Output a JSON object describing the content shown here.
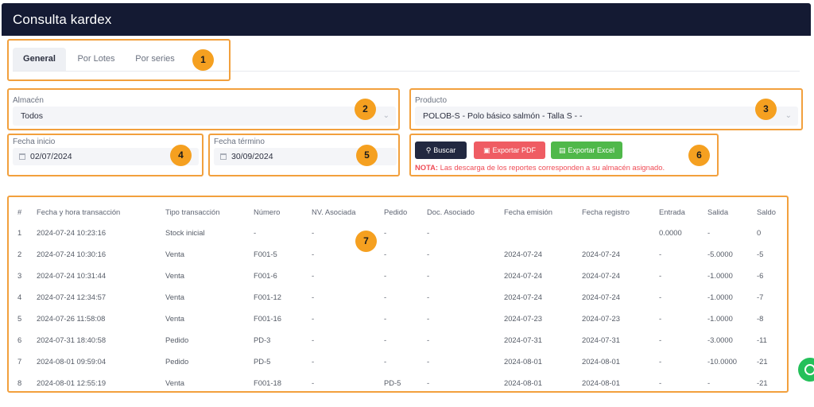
{
  "header": {
    "title": "Consulta kardex"
  },
  "tabs": [
    {
      "label": "General",
      "active": true
    },
    {
      "label": "Por Lotes",
      "active": false
    },
    {
      "label": "Por series",
      "active": false
    }
  ],
  "filters": {
    "almacen": {
      "label": "Almacén",
      "value": "Todos"
    },
    "producto": {
      "label": "Producto",
      "value": "POLOB-S - Polo básico salmón - Talla S  -  -"
    },
    "fecha_inicio": {
      "label": "Fecha inicio",
      "value": "02/07/2024"
    },
    "fecha_termino": {
      "label": "Fecha término",
      "value": "30/09/2024"
    }
  },
  "actions": {
    "buscar": "Buscar",
    "exportar_pdf": "Exportar PDF",
    "exportar_excel": "Exportar Excel",
    "nota_label": "NOTA:",
    "nota_text": " Las descarga de los reportes corresponden a su almacén asignado."
  },
  "annotations": [
    "1",
    "2",
    "3",
    "4",
    "5",
    "6",
    "7"
  ],
  "colors": {
    "header_bg": "#141a33",
    "highlight": "#f2a03d",
    "badge": "#f5a020",
    "btn_dark": "#222840",
    "btn_red": "#ef5c63",
    "btn_green": "#4fb84a"
  },
  "table": {
    "columns": [
      "#",
      "Fecha y hora transacción",
      "Tipo transacción",
      "Número",
      "NV. Asociada",
      "Pedido",
      "Doc. Asociado",
      "Fecha emisión",
      "Fecha registro",
      "Entrada",
      "Salida",
      "Saldo"
    ],
    "rows": [
      [
        "1",
        "2024-07-24 10:23:16",
        "Stock inicial",
        "-",
        "-",
        "-",
        "-",
        "",
        "",
        "0.0000",
        "-",
        "0"
      ],
      [
        "2",
        "2024-07-24 10:30:16",
        "Venta",
        "F001-5",
        "-",
        "-",
        "-",
        "2024-07-24",
        "2024-07-24",
        "-",
        "-5.0000",
        "-5"
      ],
      [
        "3",
        "2024-07-24 10:31:44",
        "Venta",
        "F001-6",
        "-",
        "-",
        "-",
        "2024-07-24",
        "2024-07-24",
        "-",
        "-1.0000",
        "-6"
      ],
      [
        "4",
        "2024-07-24 12:34:57",
        "Venta",
        "F001-12",
        "-",
        "-",
        "-",
        "2024-07-24",
        "2024-07-24",
        "-",
        "-1.0000",
        "-7"
      ],
      [
        "5",
        "2024-07-26 11:58:08",
        "Venta",
        "F001-16",
        "-",
        "-",
        "-",
        "2024-07-23",
        "2024-07-23",
        "-",
        "-1.0000",
        "-8"
      ],
      [
        "6",
        "2024-07-31 18:40:58",
        "Pedido",
        "PD-3",
        "-",
        "-",
        "-",
        "2024-07-31",
        "2024-07-31",
        "-",
        "-3.0000",
        "-11"
      ],
      [
        "7",
        "2024-08-01 09:59:04",
        "Pedido",
        "PD-5",
        "-",
        "-",
        "-",
        "2024-08-01",
        "2024-08-01",
        "-",
        "-10.0000",
        "-21"
      ],
      [
        "8",
        "2024-08-01 12:55:19",
        "Venta",
        "F001-18",
        "-",
        "PD-5",
        "-",
        "2024-08-01",
        "2024-08-01",
        "-",
        "-",
        "-21"
      ]
    ]
  }
}
